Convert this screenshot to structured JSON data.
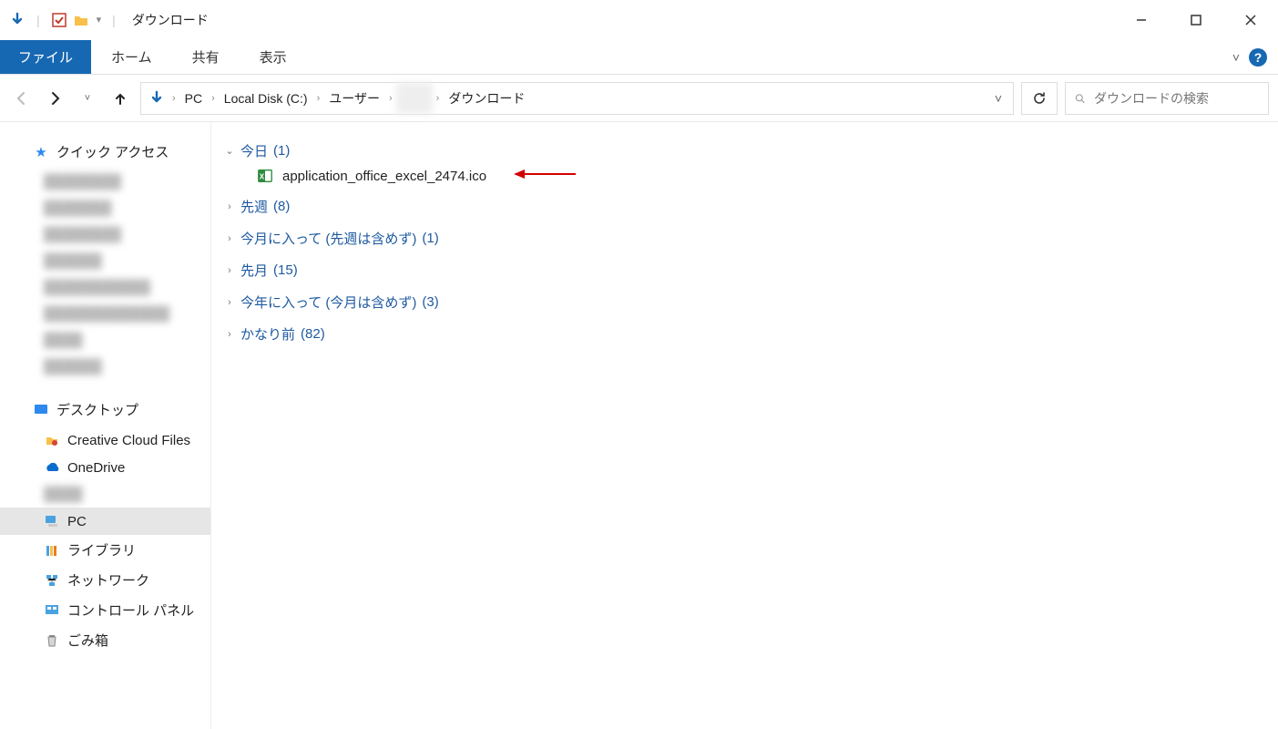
{
  "title": "ダウンロード",
  "ribbon": {
    "file": "ファイル",
    "tabs": [
      "ホーム",
      "共有",
      "表示"
    ]
  },
  "breadcrumbs": [
    "PC",
    "Local Disk (C:)",
    "ユーザー",
    "",
    "ダウンロード"
  ],
  "search": {
    "placeholder": "ダウンロードの検索"
  },
  "sidebar": {
    "quick_access": "クイック アクセス",
    "desktop": "デスクトップ",
    "items": [
      {
        "label": "Creative Cloud Files"
      },
      {
        "label": "OneDrive"
      },
      {
        "label": ""
      },
      {
        "label": "PC",
        "selected": true
      },
      {
        "label": "ライブラリ"
      },
      {
        "label": "ネットワーク"
      },
      {
        "label": "コントロール パネル"
      },
      {
        "label": "ごみ箱"
      }
    ]
  },
  "groups": [
    {
      "name": "今日",
      "count": "(1)",
      "expanded": true,
      "files": [
        {
          "name": "application_office_excel_2474.ico"
        }
      ]
    },
    {
      "name": "先週",
      "count": "(8)",
      "expanded": false
    },
    {
      "name": "今月に入って (先週は含めず)",
      "count": "(1)",
      "expanded": false
    },
    {
      "name": "先月",
      "count": "(15)",
      "expanded": false
    },
    {
      "name": "今年に入って (今月は含めず)",
      "count": "(3)",
      "expanded": false
    },
    {
      "name": "かなり前",
      "count": "(82)",
      "expanded": false
    }
  ]
}
